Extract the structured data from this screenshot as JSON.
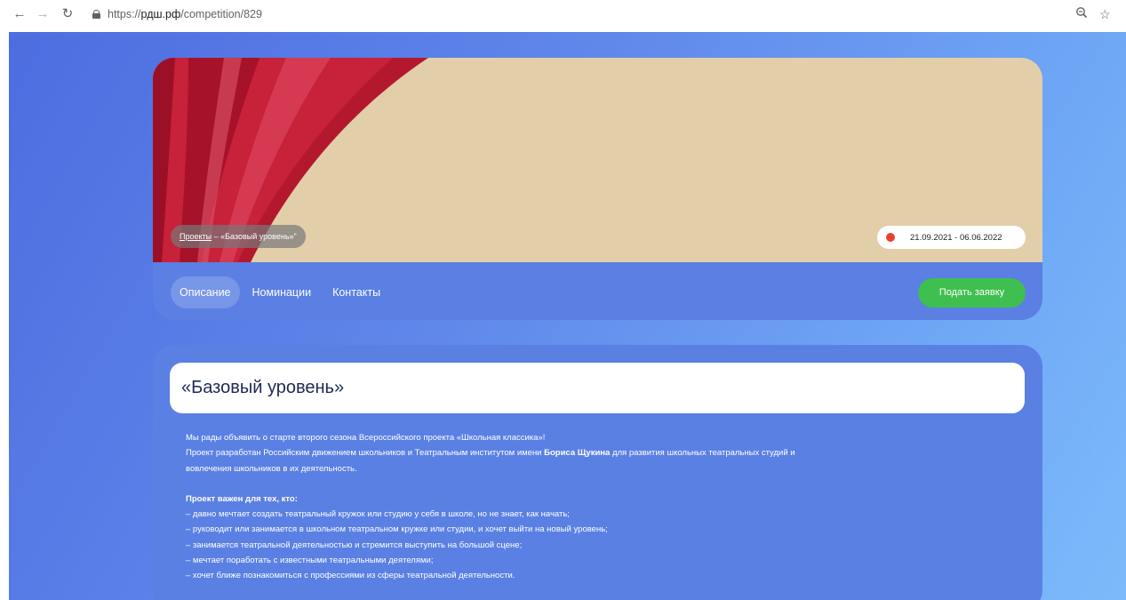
{
  "browser": {
    "url_prefix": "https://",
    "url_domain": "рдш.рф",
    "url_path": "/competition/829",
    "back_icon": "arrow-left-icon",
    "forward_icon": "arrow-right-icon",
    "reload_icon": "reload-icon"
  },
  "hero": {
    "breadcrumb_link": "Проекты",
    "breadcrumb_rest": " – «Базовый уровень»\"",
    "dates": "21.09.2021 - 06.06.2022"
  },
  "tabs": [
    {
      "label": "Описание",
      "active": true
    },
    {
      "label": "Номинации",
      "active": false
    },
    {
      "label": "Контакты",
      "active": false
    }
  ],
  "apply_button": "Подать заявку",
  "content": {
    "title": "«Базовый уровень»",
    "intro_line1": "Мы рады объявить о старте второго сезона Всероссийского проекта «Школьная классика»!",
    "intro_line2_a": "Проект разработан Российским движением школьников и Театральным институтом имени ",
    "intro_line2_bold": "Бориса Щукина",
    "intro_line2_b": " для развития школьных театральных студий и",
    "intro_line3": "вовлечения школьников в их деятельность.",
    "audience_heading": "Проект важен для тех, кто:",
    "audience_items": [
      "– давно мечтает создать театральный кружок или студию у себя в школе, но не знает, как начать;",
      "– руководит или занимается в школьном театральном кружке или студии, и хочет выйти на новый уровень;",
      "– занимается театральной деятельностью и стремится выступить на большой сцене;",
      "– мечтает поработать с известными театральными деятелями;",
      "– хочет ближе познакомиться с профессиями из сферы театральной деятельности."
    ]
  },
  "colors": {
    "accent_green": "#3fbf4f",
    "banner_beige": "#e3ceaa",
    "curtain_red": "#c8213a",
    "status_dot": "#e8402f"
  }
}
